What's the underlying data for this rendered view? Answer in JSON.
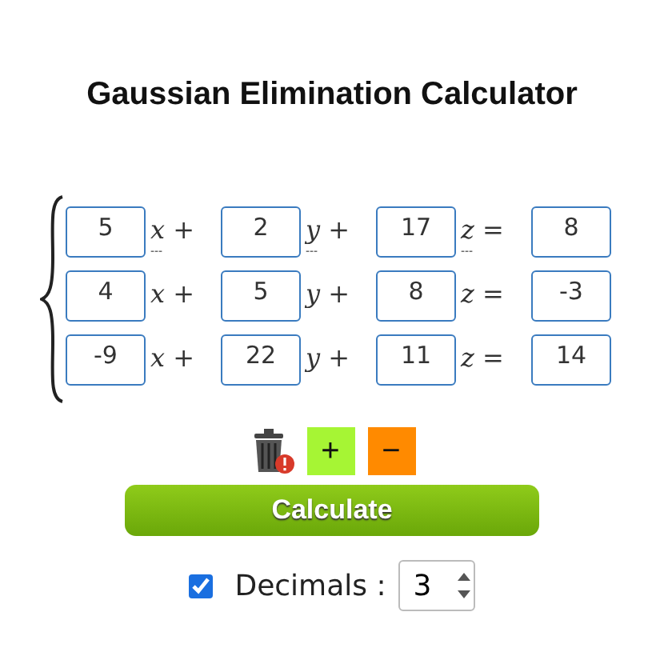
{
  "title": "Gaussian Elimination Calculator",
  "equations": [
    {
      "terms": [
        {
          "value": "5",
          "variable": "x",
          "operator": "+",
          "hint": "---"
        },
        {
          "value": "2",
          "variable": "y",
          "operator": "+",
          "hint": "---"
        },
        {
          "value": "17",
          "variable": "z",
          "operator": "=",
          "hint": "---"
        }
      ],
      "rhs": "8"
    },
    {
      "terms": [
        {
          "value": "4",
          "variable": "x",
          "operator": "+"
        },
        {
          "value": "5",
          "variable": "y",
          "operator": "+"
        },
        {
          "value": "8",
          "variable": "z",
          "operator": "="
        }
      ],
      "rhs": "-3"
    },
    {
      "terms": [
        {
          "value": "-9",
          "variable": "x",
          "operator": "+"
        },
        {
          "value": "22",
          "variable": "y",
          "operator": "+"
        },
        {
          "value": "11",
          "variable": "z",
          "operator": "="
        }
      ],
      "rhs": "14"
    }
  ],
  "tools": [
    {
      "kind": "clear"
    },
    {
      "kind": "add",
      "label": "+"
    },
    {
      "kind": "remove",
      "label": "−"
    }
  ],
  "calculate_button": "Calculate",
  "decimals": {
    "checked": true,
    "label": "Decimals :",
    "value": "3"
  }
}
